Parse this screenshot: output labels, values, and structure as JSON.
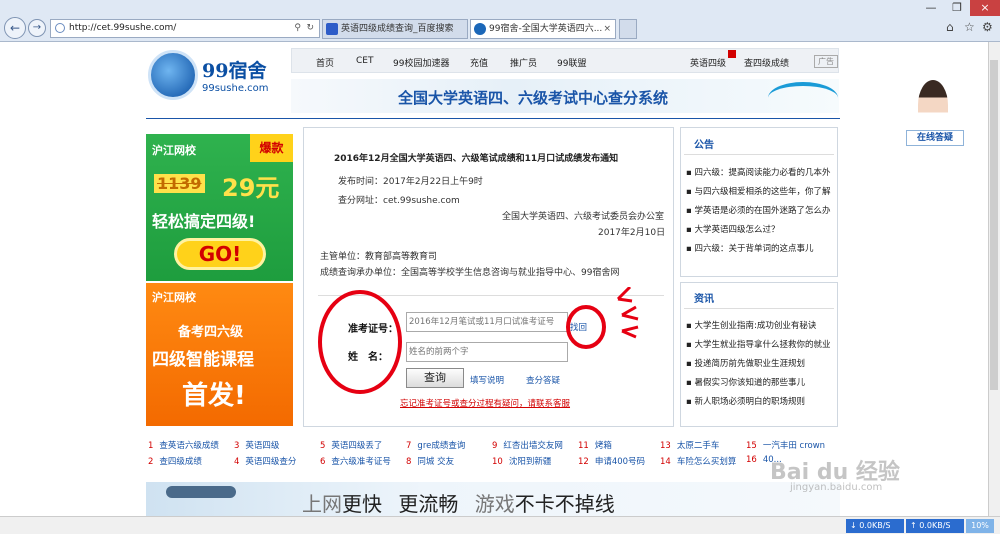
{
  "browser": {
    "url": "http://cet.99sushe.com/",
    "tabs": [
      "英语四级成绩查询_百度搜索",
      "99宿舍-全国大学英语四六..."
    ]
  },
  "site": {
    "logo": "99宿舍",
    "logo_sub": "99sushe.com",
    "nav": [
      "首页",
      "CET",
      "99校园加速器",
      "充值",
      "推广员",
      "99联盟"
    ],
    "right_links": [
      "英语四级",
      "查四级成绩"
    ],
    "ad_tag": "广告",
    "banner_title": "全国大学英语四、六级考试中心查分系统"
  },
  "ads": {
    "ad1_brand": "沪江网校",
    "ad1_badge": "爆款",
    "ad1_price_old": "1139",
    "ad1_price_new": "29元",
    "ad1_slogan": "轻松搞定四级!",
    "ad1_go": "GO!",
    "ad2_brand": "沪江网校",
    "ad2_line1": "备考四六级",
    "ad2_line2": "四级智能课程",
    "ad2_line3": "首发!"
  },
  "notice": {
    "title": "2016年12月全国大学英语四、六级笔试成绩和11月口试成绩发布通知",
    "publish_time": "发布时间：2017年2月22日上午9时",
    "site": "查分网址：cet.99sushe.com",
    "office": "全国大学英语四、六级考试委员会办公室",
    "date": "2017年2月10日",
    "sponsor": "主管单位：教育部高等教育司",
    "host": "成绩查询承办单位：全国高等学校学生信息咨询与就业指导中心、99宿舍网"
  },
  "form": {
    "id_label": "准考证号：",
    "id_placeholder": "2016年12月笔试或11月口试准考证号",
    "find": "找回",
    "name_label": "姓　名：",
    "name_placeholder": "姓名的前两个字",
    "submit": "查询",
    "help": "填写说明",
    "faq": "查分答疑",
    "forgot": "忘记准考证号或查分过程有疑问，请联系客服"
  },
  "announce": {
    "title": "公告",
    "items": [
      "四六级：提高阅读能力必看的几本外",
      "与四六级相爱相杀的这些年，你了解",
      "学英语是必须的在国外迷路了怎么办",
      "大学英语四级怎么过？",
      "四六级：关于背单词的这点事儿"
    ]
  },
  "news": {
    "title": "资讯",
    "items": [
      "大学生创业指南:成功创业有秘诀",
      "大学生就业指导拿什么拯救你的就业",
      "投递简历前先做职业生涯规划",
      "暑假实习你该知道的那些事儿",
      "新人职场必须明白的职场规则"
    ]
  },
  "bottom_links": [
    [
      "1",
      "查英语六级成绩"
    ],
    [
      "3",
      "英语四级"
    ],
    [
      "5",
      "英语四级丢了"
    ],
    [
      "7",
      "gre成绩查询"
    ],
    [
      "9",
      "红杏出墙交友网"
    ],
    [
      "11",
      "烤箱"
    ],
    [
      "13",
      "太原二手车"
    ],
    [
      "15",
      "一汽丰田 crown"
    ],
    [
      "2",
      "查四级成绩"
    ],
    [
      "4",
      "英语四级查分"
    ],
    [
      "6",
      "查六级准考证号"
    ],
    [
      "8",
      "同城 交友"
    ],
    [
      "10",
      "沈阳到新疆"
    ],
    [
      "12",
      "申请400号码"
    ],
    [
      "14",
      "车险怎么买划算"
    ],
    [
      "16",
      "40..."
    ]
  ],
  "bottom_banner": {
    "p1": "上网",
    "p2": "更快",
    "p3": "更流畅",
    "p4": "游戏",
    "p5": "不卡不掉线"
  },
  "service": "在线答疑",
  "status": {
    "down": "0.0KB/S",
    "up": "0.0KB/S",
    "pct": "10%"
  },
  "watermark": {
    "main": "Bai du 经验",
    "sub": "jingyan.baidu.com"
  }
}
